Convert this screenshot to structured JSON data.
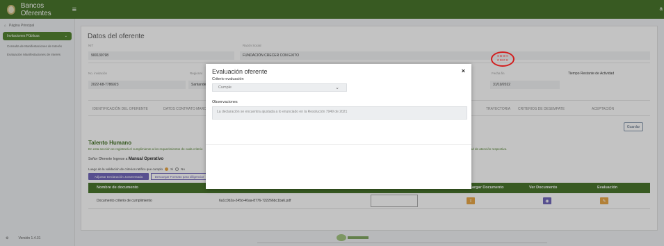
{
  "topbar": {
    "app_title": "Bancos Oferentes",
    "menu_glyph": "≡",
    "right_char": "a"
  },
  "sidebar": {
    "home": "Página Principal",
    "section": "Invitaciones Públicas",
    "links": [
      "Consulta de Manifestaciones de Interés",
      "Evaluación Manifestaciones de Interés"
    ],
    "version": "Versión 1.4.31",
    "version_icon": "⚙"
  },
  "main": {
    "title": "Datos del oferente",
    "fields": {
      "nit_label": "NIT",
      "nit_value": "900139798",
      "razon_label": "Razón Social",
      "razon_value": "FUNDACIÓN CRECER CON EXITO",
      "invitacion_label": "No. invitación",
      "invitacion_value": "2022-68-7786923",
      "regional_label": "Regional",
      "regional_value": "Santander",
      "fecha_label": "Fecha fin",
      "fecha_value": "31/10/2022",
      "tiempo_label": "Tiempo Restante de Actividad",
      "tiempo_value_1": "0 D 0 H",
      "tiempo_value_2": "0 M 0 S"
    },
    "tabs": [
      "IDENTIFICACIÓN DEL OFERENTE",
      "DATOS CONTRATO MARCO",
      "TRAYECTORIA",
      "CRITERIOS DE DESEMPATE",
      "ACEPTACIÓN"
    ],
    "save_label": "Guardar",
    "section_title": "Talento Humano",
    "section_desc": "En esta sección se registrará el cumplimiento a los requerimientos de cada criterio",
    "section_desc_2": "modalidad de atención respectiva.",
    "manual_prefix": "Señor Oferente Ingrese a",
    "manual_link": "Manual Operativo",
    "validation_text": "Luego de la validación de criterios ratifico que cumplo",
    "radio_yes": "Si",
    "radio_no": "No",
    "btn_declaracion": "Adjuntar Declaración Juramentada",
    "btn_descargar": "Descargar Formato para diligenciar",
    "table": {
      "headers": [
        "Nombre de documento",
        "Cargar Documento",
        "Ver Documento",
        "Evaluación"
      ],
      "rows": [
        {
          "name": "Documento criterio de cumplimiento",
          "file": "6a1c0b2a-245d-40aa-8776-722266bc1ba6.pdf"
        }
      ]
    }
  },
  "modal": {
    "title": "Evaluación oferente",
    "close": "×",
    "criterio_label": "Criterio evaluación",
    "criterio_value": "Cumple",
    "chevron": "⌄",
    "obs_label": "Observaciones",
    "obs_value": "La declaración se encuentra ajustada a lo enunciado en la Resolución 7949 de 2021"
  },
  "colors": {
    "brand_green": "#3f6e21",
    "accent_purple": "#6a5fb8",
    "accent_orange": "#e8a33d",
    "alert_red": "#d21f1f"
  }
}
